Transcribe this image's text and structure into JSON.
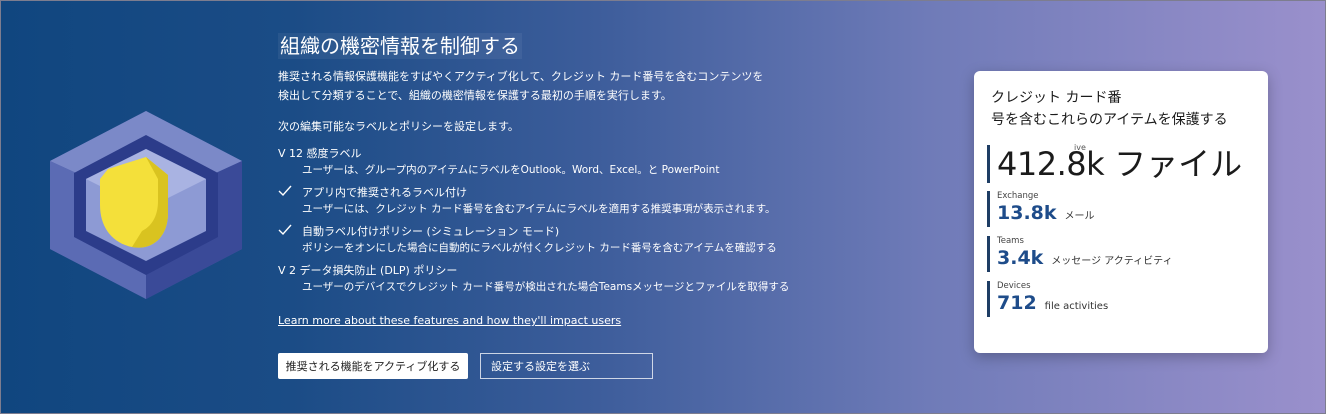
{
  "title": "組織の機密情報を制御する",
  "description": "推奨される情報保護機能をすばやくアクティブ化して、クレジット カード番号を含むコンテンツを検出して分類することで、組織の機密情報を保護する最初の手順を実行します。",
  "intro": "次の編集可能なラベルとポリシーを設定します。",
  "features": [
    {
      "marker": "V",
      "title": "12 感度ラベル",
      "subtitle": "ユーザーは、グループ内のアイテムにラベルをOutlook。Word、Excel。と PowerPoint"
    },
    {
      "marker": "check",
      "title": "アプリ内で推奨されるラベル付け",
      "subtitle": "ユーザーには、クレジット カード番号を含むアイテムにラベルを適用する推奨事項が表示されます。"
    },
    {
      "marker": "check",
      "title": "自動ラベル付けポリシー (シミュレーション モード)",
      "subtitle": "ポリシーをオンにした場合に自動的にラベルが付くクレジット カード番号を含むアイテムを確認する"
    },
    {
      "marker": "V",
      "title": "2 データ損失防止 (DLP) ポリシー",
      "subtitle": "ユーザーのデバイスでクレジット カード番号が検出された場合Teamsメッセージとファイルを取得する"
    }
  ],
  "learn_more": "Learn more about these features and how they'll impact users",
  "buttons": {
    "primary": "推奨される機能をアクティブ化する",
    "secondary": "設定する設定を選ぶ"
  },
  "card": {
    "title": "クレジット カード番号を含むこれらのアイテムを保護する",
    "title_line1": "クレジット カード番",
    "title_line2": "号を含むこれらのアイテムを保護する",
    "overlap_text": "ive",
    "total_value": "412.8k",
    "total_unit": "ファイル",
    "stats": [
      {
        "label": "Exchange",
        "value": "13.8k",
        "unit": "メール"
      },
      {
        "label": "Teams",
        "value": "3.4k",
        "unit": "メッセージ アクティビティ"
      },
      {
        "label": "Devices",
        "value": "712",
        "unit": "file activities"
      }
    ]
  },
  "colors": {
    "accent": "#1e4c8a",
    "shield": "#f4e03a",
    "hex_outer": "#4d5ea8",
    "hex_inner": "#2c3c8a"
  },
  "icons": [
    "shield-hexagon-icon",
    "checkmark-icon"
  ]
}
